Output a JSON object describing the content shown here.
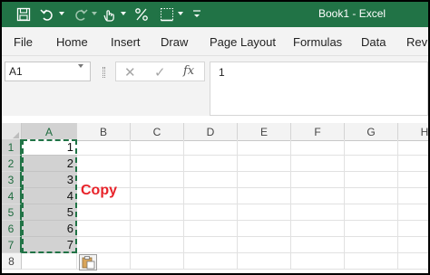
{
  "titlebar": {
    "document_title": "Book1  -  Excel",
    "qat_icons": [
      "save-icon",
      "undo-icon",
      "redo-icon",
      "touch-mode-icon",
      "percent-style-icon",
      "borders-icon",
      "customize-qat-icon"
    ]
  },
  "ribbon": {
    "tabs": [
      "File",
      "Home",
      "Insert",
      "Draw",
      "Page Layout",
      "Formulas",
      "Data",
      "Revie"
    ]
  },
  "formula_bar": {
    "name_box": "A1",
    "cancel_symbol": "✕",
    "enter_symbol": "✓",
    "fx_label": "fx",
    "formula_value": "1"
  },
  "sheet": {
    "columns": [
      "A",
      "B",
      "C",
      "D",
      "E",
      "F",
      "G",
      "H"
    ],
    "selected_column": "A",
    "rows": [
      "1",
      "2",
      "3",
      "4",
      "5",
      "6",
      "7",
      "8"
    ],
    "column_a_values": [
      "1",
      "2",
      "3",
      "4",
      "5",
      "6",
      "7"
    ],
    "active_cell": "A1",
    "copied_range": "A1:A7"
  },
  "annotation": {
    "copy_label": "Copy"
  },
  "colors": {
    "excel_green": "#217346",
    "annotation_red": "#e8232a"
  }
}
